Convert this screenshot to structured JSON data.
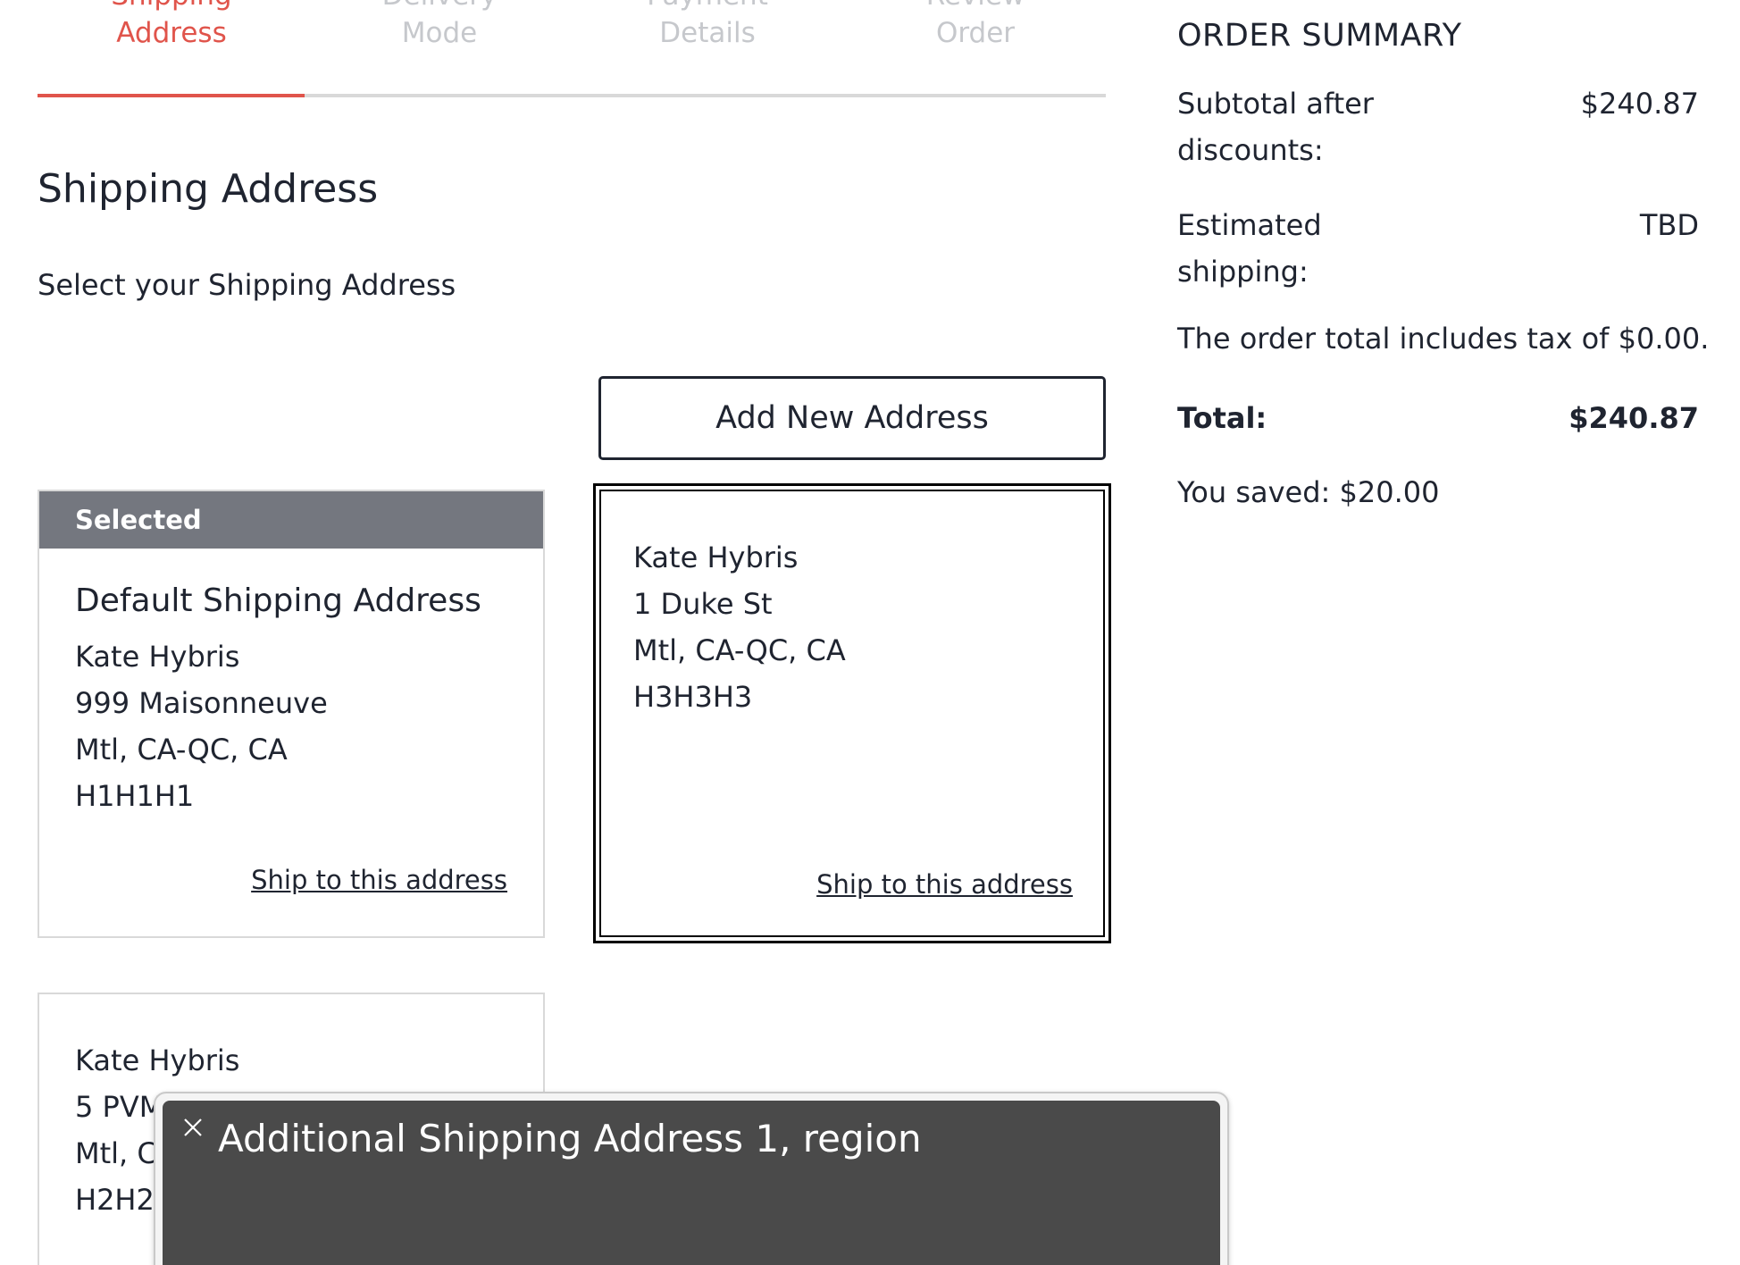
{
  "steps": [
    {
      "line1": "Shipping",
      "line2": "Address",
      "state": "active"
    },
    {
      "line1": "Delivery",
      "line2": "Mode",
      "state": "inactive"
    },
    {
      "line1": "Payment",
      "line2": "Details",
      "state": "inactive"
    },
    {
      "line1": "Review",
      "line2": "Order",
      "state": "inactive"
    }
  ],
  "progress": {
    "completed_fraction": 0.25
  },
  "main": {
    "title": "Shipping Address",
    "subtitle": "Select your Shipping Address",
    "add_address_label": "Add New Address"
  },
  "addresses": [
    {
      "badge": "Selected",
      "title": "Default Shipping Address",
      "name": "Kate Hybris",
      "street": "999 Maisonneuve",
      "city": "Mtl, CA-QC, CA",
      "postal": "H1H1H1",
      "action": "Ship to this address"
    },
    {
      "name": "Kate Hybris",
      "street": "1 Duke St",
      "city": "Mtl, CA-QC, CA",
      "postal": "H3H3H3",
      "action": "Ship to this address"
    },
    {
      "name": "Kate Hybris",
      "street": "5 PVM",
      "city": "Mtl, C",
      "postal": "H2H2"
    }
  ],
  "summary": {
    "title": "ORDER SUMMARY",
    "subtotal_label_1": "Subtotal after",
    "subtotal_label_2": "discounts:",
    "subtotal_value": "$240.87",
    "shipping_label_1": "Estimated",
    "shipping_label_2": "shipping:",
    "shipping_value": "TBD",
    "tax_note": "The order total includes tax of $0.00.",
    "total_label": "Total:",
    "total_value": "$240.87",
    "saved_note": "You saved: $20.00"
  },
  "screen_reader": {
    "text": "Additional Shipping Address 1, region",
    "close_icon": "close-icon"
  },
  "colors": {
    "accent": "#e0544b",
    "inactive_step": "#c6c8cc",
    "badge_bg": "#74777f",
    "overlay_bg": "#4a4a4a"
  }
}
